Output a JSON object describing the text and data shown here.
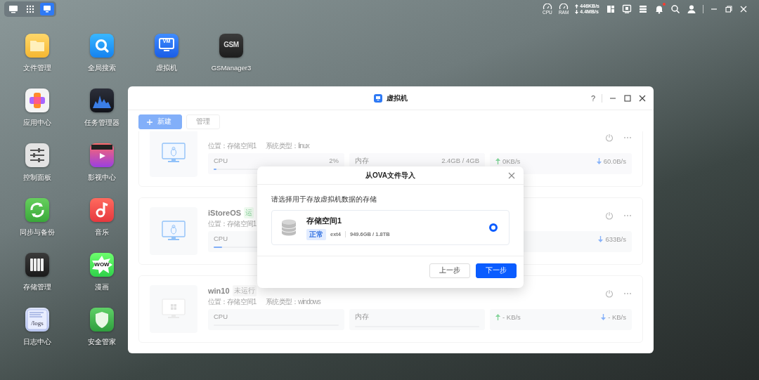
{
  "taskbar": {
    "left_icons": [
      {
        "kind": "desktop",
        "selected": false
      },
      {
        "kind": "apps",
        "selected": false
      },
      {
        "kind": "vm",
        "selected": true
      }
    ],
    "gauges": [
      {
        "label": "CPU"
      },
      {
        "label": "RAM"
      }
    ],
    "network": {
      "up": "446KB/s",
      "down": "4.4MB/s"
    },
    "tray_icons": [
      {
        "kind": "layout",
        "badge": false
      },
      {
        "kind": "monitor",
        "badge": false
      },
      {
        "kind": "list",
        "badge": false
      },
      {
        "kind": "bell",
        "badge": true
      },
      {
        "kind": "search",
        "badge": false
      },
      {
        "kind": "user",
        "badge": false
      }
    ],
    "window_controls": [
      {
        "kind": "minimize"
      },
      {
        "kind": "restore"
      },
      {
        "kind": "close"
      }
    ]
  },
  "desktop": {
    "columns": [
      [
        {
          "label": "文件管理",
          "kind": "folder"
        },
        {
          "label": "应用中心",
          "kind": "appcenter"
        },
        {
          "label": "控制面板",
          "kind": "control"
        },
        {
          "label": "同步与备份",
          "kind": "sync"
        },
        {
          "label": "存储管理",
          "kind": "storage"
        },
        {
          "label": "日志中心",
          "kind": "logs",
          "icon_text": "/logs"
        }
      ],
      [
        {
          "label": "全局搜索",
          "kind": "search"
        },
        {
          "label": "任务管理器",
          "kind": "taskmgr"
        },
        {
          "label": "影视中心",
          "kind": "video"
        },
        {
          "label": "音乐",
          "kind": "music"
        },
        {
          "label": "漫画",
          "kind": "comic",
          "icon_text": "WOW"
        },
        {
          "label": "安全管家",
          "kind": "shield"
        }
      ],
      [
        {
          "label": "虚拟机",
          "kind": "vm",
          "icon_text": "VM"
        }
      ],
      [
        {
          "label": "GSManager3",
          "kind": "gsm",
          "icon_text": "GSM"
        }
      ]
    ]
  },
  "window": {
    "title": "虚拟机",
    "help": "?",
    "controls": [
      {
        "kind": "minimize"
      },
      {
        "kind": "maximize"
      },
      {
        "kind": "close"
      }
    ],
    "toolbar": [
      {
        "label": "新建",
        "kind": "primary"
      },
      {
        "label": "管理",
        "kind": "default"
      }
    ],
    "vms": [
      {
        "kind": "linux",
        "location": "位置：存储空间1",
        "os_type": "系统类型：linux",
        "cpu": {
          "label": "CPU",
          "value": "2%",
          "level": 0.02
        },
        "memory": {
          "label": "内存",
          "value": "2.4GB / 4GB"
        },
        "network": {
          "up": "0KB/s",
          "down": "60.0B/s"
        }
      },
      {
        "kind": "linux",
        "name": "iStoreOS",
        "status": {
          "label": "运",
          "kind": "running"
        },
        "location": "位置：存储空间1",
        "cpu": {
          "label": "CPU",
          "level": 0.07
        },
        "network": {
          "down": "633B/s"
        }
      },
      {
        "kind": "windows",
        "name": "win10",
        "status": {
          "label": "未运行",
          "kind": "stopped"
        },
        "location": "位置：存储空间1",
        "os_type": "系统类型：windows",
        "cpu": {
          "label": "CPU",
          "level": 0
        },
        "memory": {
          "label": "内存",
          "level": 0
        },
        "network": {
          "up": "- KB/s",
          "down": "- KB/s"
        }
      }
    ]
  },
  "dialog": {
    "title": "从OVA文件导入",
    "prompt": "请选择用于存放虚拟机数据的存储",
    "options": [
      {
        "name": "存储空间1",
        "status": "正常",
        "fs": "ext4",
        "usage": "949.6GB / 1.8TB",
        "selected": true
      }
    ],
    "buttons": [
      {
        "label": "上一步",
        "kind": "default"
      },
      {
        "label": "下一步",
        "kind": "primary"
      }
    ]
  }
}
